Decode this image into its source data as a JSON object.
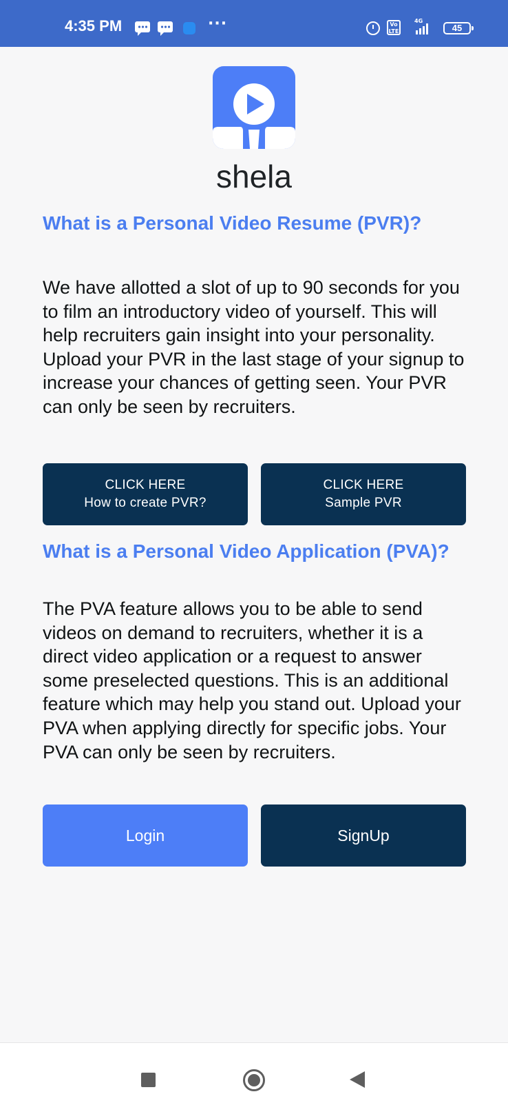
{
  "status_bar": {
    "time": "4:35 PM",
    "battery": "45",
    "network": "4G",
    "volte": "Vo LTE",
    "more": "···"
  },
  "brand": {
    "name": "shela",
    "tile_color": "#4d7ef7"
  },
  "pvr": {
    "title": "What is a Personal Video Resume (PVR)?",
    "body": "We have allotted a slot of up to 90 seconds for you to film an introductory video of yourself. This will help recruiters gain insight into your personality. Upload your PVR in the last stage of your signup to increase your chances of getting seen. Your PVR can only be seen by recruiters.",
    "buttons": [
      {
        "line1": "CLICK HERE",
        "line2": "How to create PVR?"
      },
      {
        "line1": "CLICK HERE",
        "line2": "Sample PVR"
      }
    ]
  },
  "pva": {
    "title": "What is a Personal Video Application (PVA)?",
    "body": "The PVA feature allows you to be able to send videos on demand to recruiters, whether it is a direct video application or a request to answer some preselected questions. This is an additional feature which may help you stand out. Upload your PVA when applying directly for specific jobs. Your PVA can only be seen by recruiters."
  },
  "auth": {
    "login_label": "Login",
    "signup_label": "SignUp"
  },
  "colors": {
    "status_bar": "#3d6ac9",
    "heading": "#4b7ef0",
    "button_dark": "#0a3152",
    "button_blue": "#4d7ef7"
  },
  "icons": {
    "nav_recents": "square-recents-icon",
    "nav_home": "circle-home-icon",
    "nav_back": "triangle-back-icon"
  }
}
